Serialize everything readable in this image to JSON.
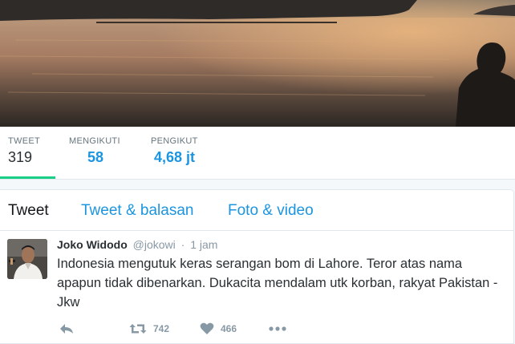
{
  "profile_stats": [
    {
      "label": "TWEET",
      "value": "319",
      "active": true
    },
    {
      "label": "MENGIKUTI",
      "value": "58",
      "active": false
    },
    {
      "label": "PENGIKUT",
      "value": "4,68 jt",
      "active": false
    }
  ],
  "timeline_tabs": [
    {
      "label": "Tweet",
      "active": true
    },
    {
      "label": "Tweet & balasan",
      "active": false
    },
    {
      "label": "Foto & video",
      "active": false
    }
  ],
  "tweet": {
    "fullname": "Joko Widodo",
    "username": "@jokowi",
    "separator": "·",
    "time": "1 jam",
    "text": "Indonesia mengutuk keras serangan bom di Lahore. Teror atas nama apapun tidak dibenarkan. Dukacita mendalam utk korban, rakyat Pakistan -Jkw",
    "actions": {
      "reply_icon": "reply-icon",
      "retweet_icon": "retweet-icon",
      "retweet_count": "742",
      "like_icon": "heart-icon",
      "like_count": "466",
      "more_icon": "more-icon"
    }
  },
  "colors": {
    "link_blue": "#1b95e0",
    "active_underline": "#19cf86",
    "muted_text": "#8899a6"
  }
}
